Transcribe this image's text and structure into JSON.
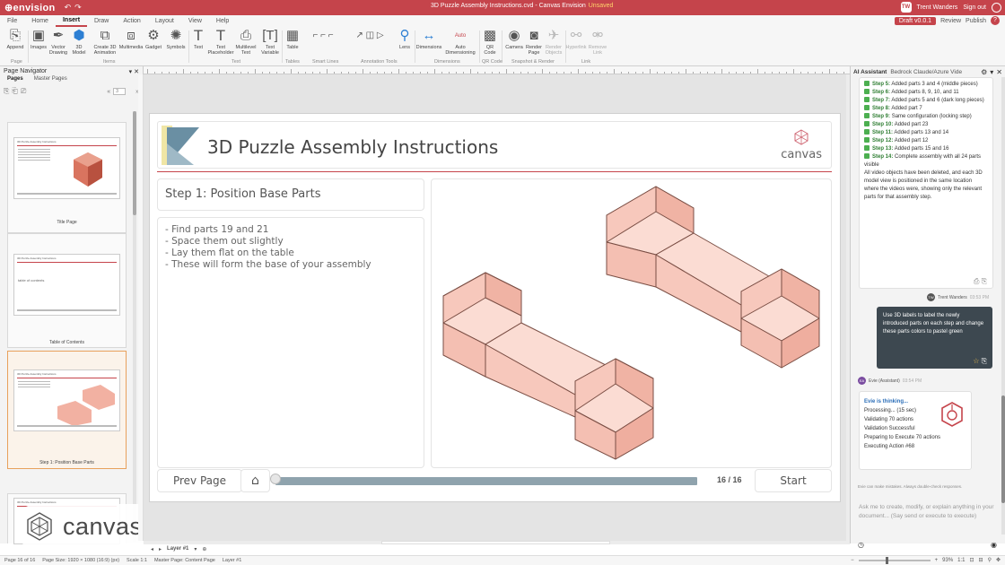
{
  "titlebar": {
    "app": "envision",
    "doc_title": "3D Puzzle Assembly Instructions.cvd - Canvas Envision",
    "unsaved": "Unsaved",
    "user_initials": "TW",
    "user_name": "Trent Wanders",
    "sign_out": "Sign out"
  },
  "menu": {
    "items": [
      "File",
      "Home",
      "Insert",
      "Draw",
      "Action",
      "Layout",
      "View",
      "Help"
    ],
    "draft": "Draft v0.0.1",
    "review": "Review",
    "publish": "Publish",
    "help_icon": "?"
  },
  "ribbon": {
    "append": "Append",
    "images": "Images",
    "vector": "Vector Drawing",
    "model3d": "3D Model",
    "create3d": "Create 3D Animation",
    "multimedia": "Multimedia",
    "gadget": "Gadget",
    "symbols": "Symbols",
    "text": "Text",
    "textph": "Text Placeholder",
    "multitext": "Multilevel Text",
    "textvar": "Text Variable",
    "table": "Table",
    "lens": "Lens",
    "dimensions": "Dimensions",
    "autodim": "Auto Dimensioning",
    "auto": "Auto",
    "qr": "QR Code",
    "camera": "Camera",
    "render": "Render Page",
    "renderobj": "Render Objects",
    "hyperlink": "Hyperlink",
    "remove": "Remove Link",
    "groups": [
      "Page",
      "Items",
      "Text",
      "Tables",
      "Smart Lines",
      "Annotation Tools",
      "Dimensions",
      "QR Code",
      "Snapshot & Render",
      "Link"
    ]
  },
  "leftpanel": {
    "title": "Page Navigator",
    "tabs": [
      "Pages",
      "Master Pages"
    ],
    "page_input": "3",
    "thumbs": [
      {
        "title": "3D Puzzle Assembly Instructions",
        "label": "Title Page"
      },
      {
        "title": "3D Puzzle Assembly Instructions",
        "label": "Table of Contents",
        "body": "table of contents"
      },
      {
        "title": "3D Puzzle Assembly Instructions",
        "label": "Step 1: Position Base Parts"
      },
      {
        "title": "3D Puzzle Assembly Instructions",
        "label": ""
      }
    ]
  },
  "slide": {
    "title": "3D Puzzle Assembly Instructions",
    "brand": "canvas",
    "step_title": "Step 1: Position Base Parts",
    "bullets": [
      "- Find parts 19 and 21",
      "- Space them out slightly",
      "- Lay them flat on the table",
      "- These will form the base of your assembly"
    ],
    "prev": "Prev Page",
    "counter": "16 / 16",
    "start": "Start",
    "colors": {
      "part_face": "#f7c8bc",
      "part_top": "#fbdcd3",
      "part_side": "#f0b3a4",
      "accent": "#c5444b"
    }
  },
  "watermark": "canvas",
  "assistant": {
    "title": "AI Assistant",
    "model": "Bedrock Claude/Azure Vide...",
    "steps": [
      {
        "label": "Step 5:",
        "text": "Added parts 3 and 4 (middle pieces)"
      },
      {
        "label": "Step 6:",
        "text": "Added parts 8, 9, 10, and 11"
      },
      {
        "label": "Step 7:",
        "text": "Added parts 5 and 6 (dark long pieces)"
      },
      {
        "label": "Step 8:",
        "text": "Added part 7"
      },
      {
        "label": "Step 9:",
        "text": "Same configuration (locking step)"
      },
      {
        "label": "Step 10:",
        "text": "Added part 23"
      },
      {
        "label": "Step 11:",
        "text": "Added parts 13 and 14"
      },
      {
        "label": "Step 12:",
        "text": "Added part 12"
      },
      {
        "label": "Step 13:",
        "text": "Added parts 15 and 16"
      },
      {
        "label": "Step 14:",
        "text": "Complete assembly with all 24 parts visible"
      }
    ],
    "summary": "All video objects have been deleted, and each 3D model view is positioned in the same location where the videos were, showing only the relevant parts for that assembly step.",
    "user_initials": "TW",
    "user_name": "Trent Wanders",
    "user_time": "03:53 PM",
    "user_msg": "Use 3D labels to label the newly introduced parts on each step and change these parts colors to pastel green",
    "bot_initials": "EA",
    "bot_name": "Evie (Assistant)",
    "bot_time": "03:54 PM",
    "thinking": [
      "Evie is thinking...",
      "Processing... (15 sec)",
      "Validating 70 actions",
      "Validation Successful",
      "Preparing to Execute 70 actions",
      "Executing Action #68"
    ],
    "disclaimer": "Evie can make mistakes. Always double-check responses.",
    "placeholder": "Ask me to create, modify, or explain anything in your document... (Say send or execute to execute)"
  },
  "layer": {
    "name": "Layer #1"
  },
  "status": {
    "page": "Page 16 of 16",
    "size": "Page Size: 1920 × 1080 (16:9) (px)",
    "scale": "Scale 1:1",
    "master": "Master Page: Content Page",
    "layer": "Layer #1",
    "zoom": "93%",
    "ratio": "1:1"
  }
}
